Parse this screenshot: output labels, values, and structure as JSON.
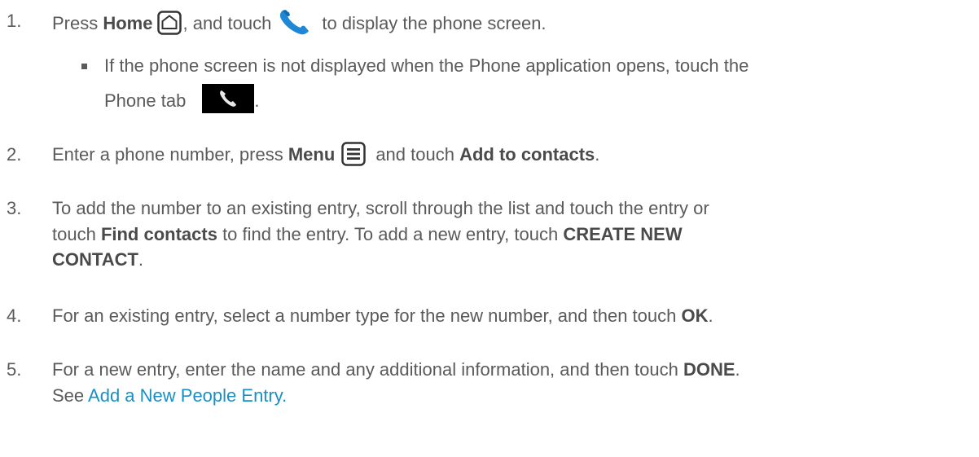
{
  "steps": [
    {
      "num": "1.",
      "t1": "Press ",
      "b1": "Home",
      "t2": ", and touch",
      "t3": "to display the phone screen."
    },
    {
      "bullet_line1": "If the phone screen is not displayed when the Phone application opens, touch the",
      "bullet_line2_text": "Phone tab",
      "bullet_line2_end": "."
    },
    {
      "num": "2.",
      "t1": "Enter a phone number, press ",
      "b1": "Menu",
      "t2": "and touch ",
      "b2": "Add to contacts",
      "t3": "."
    },
    {
      "num": "3.",
      "line1": "To add the number to an existing entry, scroll through the list and touch the entry or",
      "line2_t1": "touch ",
      "line2_b1": "Find contacts",
      "line2_t2": " to find the entry. To add a new entry, touch ",
      "line2_b2": "CREATE NEW",
      "line3_b1": "CONTACT",
      "line3_t1": "."
    },
    {
      "num": "4.",
      "t1": "For an existing entry, select a number type for the new number, and then touch ",
      "b1": "OK",
      "t2": "."
    },
    {
      "num": "5.",
      "t1": "For a new entry, enter the name and any additional information, and then touch ",
      "b1": "DONE",
      "t2": ".",
      "line2_t1": "See ",
      "line2_link": "Add a New People Entry."
    }
  ],
  "colors": {
    "text": "#5a5a5a",
    "link": "#1a8fc4",
    "handset_blue": "#1e88d6"
  },
  "icons": [
    "home-icon",
    "phone-handset-icon",
    "phone-tab-icon",
    "menu-icon"
  ]
}
